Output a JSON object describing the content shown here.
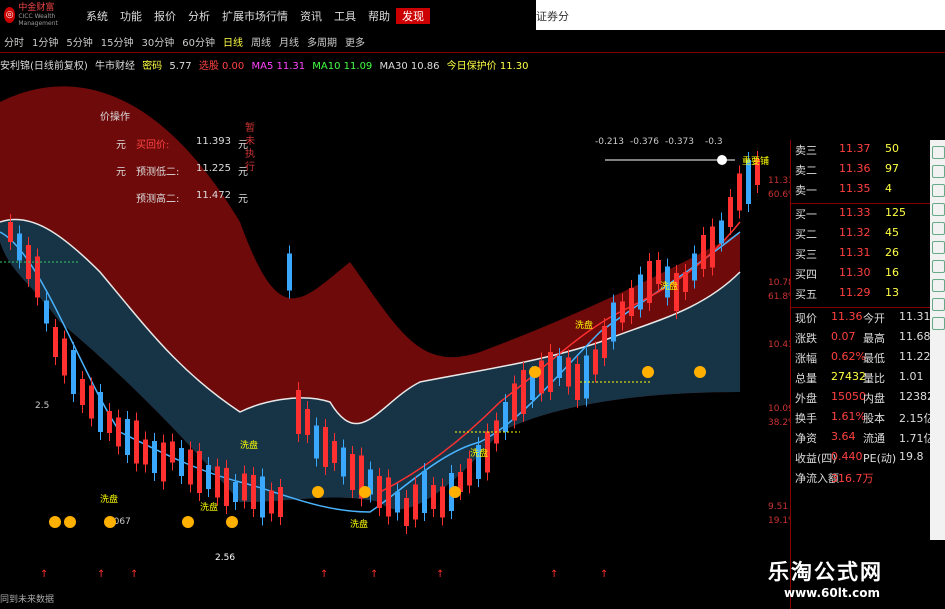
{
  "menubar": {
    "logo_text": "中金财富",
    "logo_sub": "CICC Wealth Management",
    "items": [
      "系统",
      "功能",
      "报价",
      "分析",
      "扩展市场行情",
      "资讯",
      "工具",
      "帮助"
    ],
    "active_item": "发现",
    "right_text": "证券分"
  },
  "periods": [
    "分时",
    "1分钟",
    "5分钟",
    "15分钟",
    "30分钟",
    "60分钟",
    "日线",
    "周线",
    "月线",
    "多周期",
    "更多"
  ],
  "selected_period": "日线",
  "indicators": {
    "name": "安利锦(日线前复权)",
    "formula": "牛市财经",
    "close_label": "密码",
    "close_value": "5.77",
    "ma_a": "选股 0.00",
    "ma5": "MA5 11.31",
    "ma10": "MA10 11.09",
    "ma30": "MA30 10.86",
    "today": "今日保护价 11.30"
  },
  "op_box": {
    "title": "价操作",
    "rows": [
      {
        "unit": "元",
        "label": "买回价:",
        "value": "11.393",
        "unit2": "元"
      },
      {
        "unit": "元",
        "label": "预测低二:",
        "value": "11.225",
        "unit2": "元"
      },
      {
        "unit": "",
        "label": "预测高二:",
        "value": "11.472",
        "unit2": "元"
      }
    ],
    "vertical": "暂未执行"
  },
  "y_axis": [
    "11.33",
    "60.6%",
    "10.78",
    "61.8%",
    "10.43",
    "10.09",
    "38.2%",
    "9.51",
    "19.1%"
  ],
  "top_labels": [
    "-0.213",
    "-0.376",
    "-0.373",
    "-0.3"
  ],
  "chart_annots": {
    "wash": "洗盘",
    "low_price": "2.56",
    "low_price2": "1.067",
    "fib": "2.5",
    "future": "同到未来数据",
    "peak_tag": "重要铺"
  },
  "quote_panel": {
    "sell": [
      {
        "label": "卖三",
        "price": "11.37",
        "vol": "50"
      },
      {
        "label": "卖二",
        "price": "11.36",
        "vol": "97"
      },
      {
        "label": "卖一",
        "price": "11.35",
        "vol": "4"
      }
    ],
    "buy": [
      {
        "label": "买一",
        "price": "11.33",
        "vol": "125"
      },
      {
        "label": "买二",
        "price": "11.32",
        "vol": "45"
      },
      {
        "label": "买三",
        "price": "11.31",
        "vol": "26"
      },
      {
        "label": "买四",
        "price": "11.30",
        "vol": "16"
      },
      {
        "label": "买五",
        "price": "11.29",
        "vol": "13"
      }
    ],
    "stats": [
      {
        "l1": "现价",
        "v1": "11.36",
        "l2": "今开",
        "v2": "11.31"
      },
      {
        "l1": "涨跌",
        "v1": "0.07",
        "l2": "最高",
        "v2": "11.68"
      },
      {
        "l1": "涨幅",
        "v1": "0.62%",
        "l2": "最低",
        "v2": "11.22"
      },
      {
        "l1": "总量",
        "v1": "27432",
        "l2": "量比",
        "v2": "1.01"
      },
      {
        "l1": "外盘",
        "v1": "15050",
        "l2": "内盘",
        "v2": "12382"
      },
      {
        "l1": "换手",
        "v1": "1.61%",
        "l2": "股本",
        "v2": "2.15亿"
      },
      {
        "l1": "净资",
        "v1": "3.64",
        "l2": "流通",
        "v2": "1.71亿"
      },
      {
        "l1": "收益(四)",
        "v1": "0.440",
        "l2": "PE(动)",
        "v2": "19.8"
      },
      {
        "l1": "净流入额",
        "v1": "316.7万",
        "l2": "",
        "v2": ""
      }
    ]
  },
  "watermark": {
    "title": "乐淘公式网",
    "url": "www.60lt.com"
  },
  "colors": {
    "up": "#ff3030",
    "down": "#3aa8ff",
    "upper_band": "#6e0a0a",
    "lower_band": "#173447",
    "white_line": "#e8e8e8",
    "yellow": "#ffcc00"
  },
  "chart_data": {
    "type": "candlestick",
    "y_ticks": [
      "11.33",
      "10.78",
      "10.43",
      "10.09",
      "9.51"
    ]
  }
}
